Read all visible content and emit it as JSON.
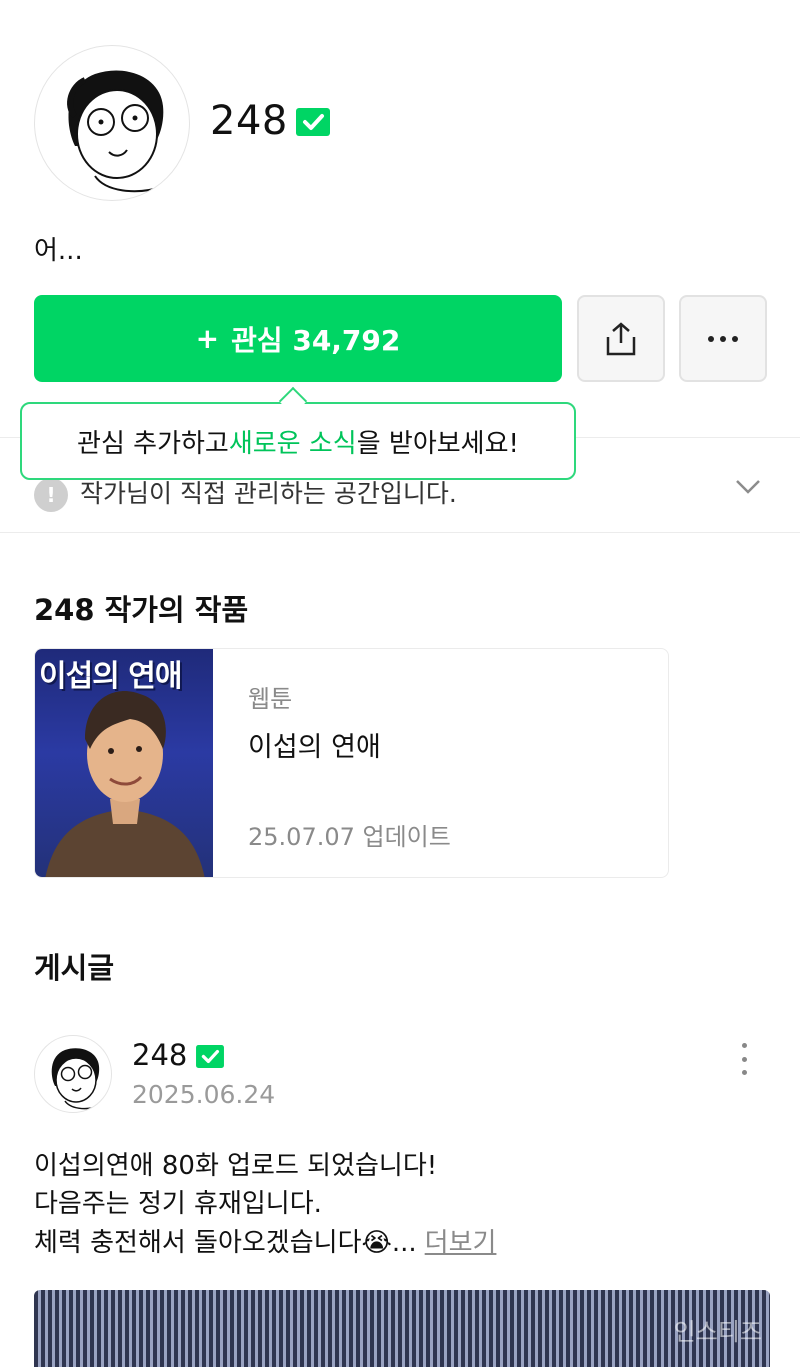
{
  "profile": {
    "name": "248",
    "bio": "어...",
    "verified_color": "#00D564"
  },
  "actions": {
    "follow_plus": "+",
    "follow_label": "관심 34,792"
  },
  "tooltip": {
    "before": "관심 추가하고 ",
    "accent": "새로운 소식",
    "after": "을 받아보세요!"
  },
  "notice": {
    "icon": "!",
    "text": "작가님이 직접 관리하는 공간입니다."
  },
  "works": {
    "title": "248 작가의 작품",
    "items": [
      {
        "cover_title": "이섭의 연애",
        "type": "웹툰",
        "name": "이섭의 연애",
        "updated": "25.07.07 업데이트"
      }
    ]
  },
  "posts": {
    "title": "게시글",
    "items": [
      {
        "author": "248",
        "date": "2025.06.24",
        "lines": [
          "이섭의연애 80화 업로드 되었습니다!",
          "다음주는 정기 휴재입니다.",
          "체력 충전해서 돌아오겠습니다😭..."
        ],
        "more_label": "더보기"
      }
    ]
  },
  "watermark": "인스티즈",
  "colors": {
    "accent": "#00D564",
    "tooltip_border": "#2ED87C"
  }
}
